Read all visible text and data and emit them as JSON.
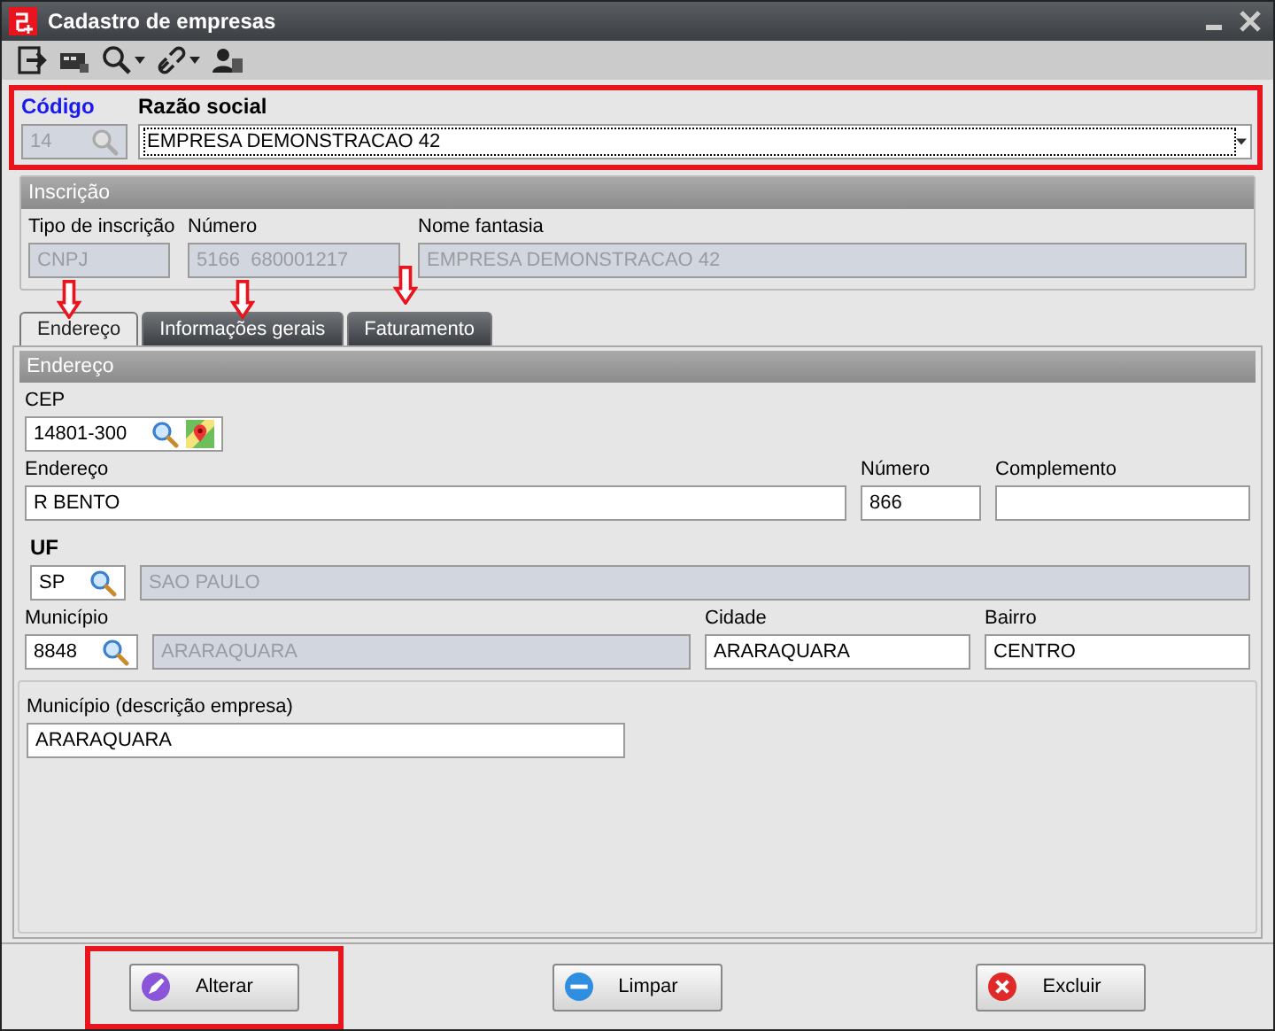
{
  "window": {
    "title": "Cadastro de empresas"
  },
  "toolbar": [
    {
      "kind": "exit"
    },
    {
      "kind": "card"
    },
    {
      "kind": "search",
      "dropdown": true
    },
    {
      "kind": "link",
      "dropdown": true
    },
    {
      "kind": "user"
    }
  ],
  "header": {
    "codigo_label": "Código",
    "codigo_value": "14",
    "razao_label": "Razão social",
    "razao_value": "EMPRESA DEMONSTRACAO 42"
  },
  "inscricao": {
    "title": "Inscrição",
    "tipo_label": "Tipo de inscrição",
    "tipo_value": "CNPJ",
    "numero_label": "Número",
    "numero_parts": [
      "5166",
      "680001217"
    ],
    "fantasia_label": "Nome fantasia",
    "fantasia_value": "EMPRESA DEMONSTRACAO 42"
  },
  "tabs": [
    {
      "label": "Endereço",
      "selected": true
    },
    {
      "label": "Informações gerais",
      "selected": false
    },
    {
      "label": "Faturamento",
      "selected": false
    }
  ],
  "endereco": {
    "title": "Endereço",
    "cep_label": "CEP",
    "cep": "14801-300",
    "endereco_label": "Endereço",
    "endereco": "R BENTO",
    "numero_label": "Número",
    "numero": "866",
    "complemento_label": "Complemento",
    "uf_label": "UF",
    "uf": "SP",
    "uf_nome": "SAO PAULO",
    "municipio_label": "Município",
    "municipio": "8848",
    "municipio_nome": "ARARAQUARA",
    "cidade_label": "Cidade",
    "cidade": "ARARAQUARA",
    "bairro_label": "Bairro",
    "bairro": "CENTRO",
    "mun_desc_label": "Município (descrição empresa)",
    "mun_desc": "ARARAQUARA"
  },
  "buttons": [
    {
      "label": "Alterar",
      "kind": "edit",
      "highlighted": true
    },
    {
      "label": "Limpar",
      "kind": "clear",
      "highlighted": false
    },
    {
      "label": "Excluir",
      "kind": "delete",
      "highlighted": false
    }
  ]
}
